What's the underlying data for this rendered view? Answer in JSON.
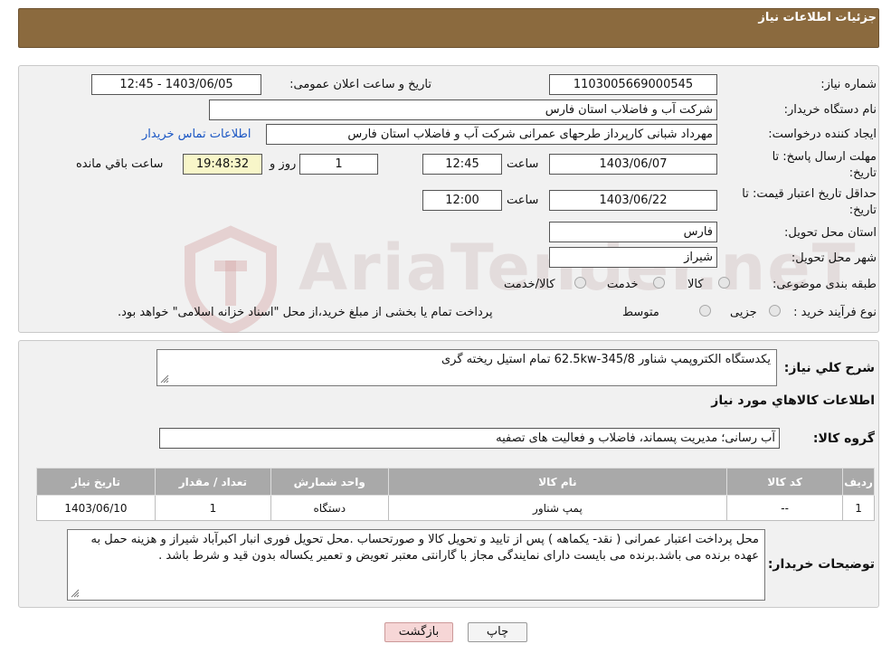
{
  "header": {
    "title": "جزئیات اطلاعات نیاز"
  },
  "form": {
    "need_number_label": "شماره نیاز:",
    "need_number": "1103005669000545",
    "announce_label": "تاریخ و ساعت اعلان عمومی:",
    "announce_value": "1403/06/05 - 12:45",
    "buyer_org_label": "نام دستگاه خریدار:",
    "buyer_org": "شرکت آب و فاضلاب استان فارس",
    "creator_label": "ایجاد کننده درخواست:",
    "creator": "مهرداد شبانی کارپرداز طرحهای عمرانی  شرکت آب و فاضلاب استان فارس",
    "contact_link": "اطلاعات تماس خریدار",
    "deadline_label_1": "مهلت ارسال پاسخ: تا",
    "deadline_label_2": "تاریخ:",
    "deadline_date": "1403/06/07",
    "time_label": "ساعت",
    "deadline_time": "12:45",
    "days_value": "1",
    "days_label": "روز و",
    "remaining_time": "19:48:32",
    "remaining_label": "ساعت باقي مانده",
    "validity_label_1": "حداقل تاریخ اعتبار قیمت: تا",
    "validity_label_2": "تاریخ:",
    "validity_date": "1403/06/22",
    "validity_time": "12:00",
    "province_label": "استان محل تحویل:",
    "province": "فارس",
    "city_label": "شهر محل تحویل:",
    "city": "شیراز",
    "category_label": "طبقه بندی موضوعی:",
    "category_options": [
      "کالا",
      "خدمت",
      "کالا/خدمت"
    ],
    "process_label": "نوع فرآیند خرید :",
    "process_options": [
      "جزیی",
      "متوسط"
    ],
    "process_note": "پرداخت تمام یا بخشی از مبلغ خرید،از محل \"اسناد خزانه اسلامی\" خواهد بود."
  },
  "details": {
    "summary_label": "شرح کلي نياز:",
    "summary": "یکدستگاه الکتروپمپ شناور 62.5kw-345/8 تمام استیل ریخته گری",
    "goods_info_title": "اطلاعات کالاهاي مورد نياز",
    "goods_group_label": "گروه کالا:",
    "goods_group": "آب رسانی؛ مدیریت پسماند، فاضلاب و فعالیت های تصفیه",
    "table": {
      "headers": [
        "رديف",
        "کد کالا",
        "نام کالا",
        "واحد شمارش",
        "تعداد / مقدار",
        "تاريخ نياز"
      ],
      "rows": [
        [
          "1",
          "--",
          "پمپ شناور",
          "دستگاه",
          "1",
          "1403/06/10"
        ]
      ]
    },
    "buyer_notes_label": "توضیحات خریدار:",
    "buyer_notes": "محل پرداخت اعتبار عمرانی ( نقد- یکماهه ) پس از تایید و تحویل کالا و صورتحساب .محل تحویل  فوری انبار اکبرآباد شیراز  و هزینه حمل به عهده برنده می باشد.برنده می بایست دارای نمایندگی مجاز با گارانتی معتبر تعویض و تعمیر یکساله بدون قید و شرط باشد ."
  },
  "buttons": {
    "print": "چاپ",
    "back": "بازگشت"
  },
  "watermark": {
    "text": "AriaTender.neT"
  },
  "colors": {
    "header_bg": "#8b6a3e",
    "table_header_bg": "#a9a9a9",
    "back_button_bg": "#f6d6d6",
    "link": "#1a56c4"
  }
}
